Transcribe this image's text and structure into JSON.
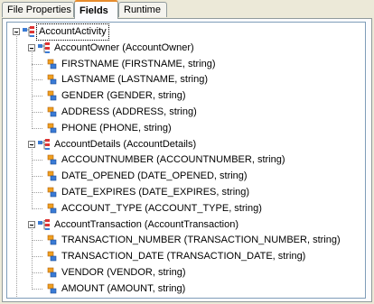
{
  "tabs": [
    {
      "label": "File Properties"
    },
    {
      "label": "Fields"
    },
    {
      "label": "Runtime"
    }
  ],
  "tree": {
    "root": "AccountActivity",
    "groups": [
      {
        "label": "AccountOwner (AccountOwner)",
        "fields": [
          "FIRSTNAME (FIRSTNAME, string)",
          "LASTNAME (LASTNAME, string)",
          "GENDER (GENDER, string)",
          "ADDRESS (ADDRESS, string)",
          "PHONE (PHONE, string)"
        ]
      },
      {
        "label": "AccountDetails (AccountDetails)",
        "fields": [
          "ACCOUNTNUMBER  (ACCOUNTNUMBER,  string)",
          "DATE_OPENED (DATE_OPENED, string)",
          "DATE_EXPIRES (DATE_EXPIRES, string)",
          "ACCOUNT_TYPE (ACCOUNT_TYPE, string)"
        ]
      },
      {
        "label": "AccountTransaction (AccountTransaction)",
        "fields": [
          "TRANSACTION_NUMBER  (TRANSACTION_NUMBER,  string)",
          "TRANSACTION_DATE  (TRANSACTION_DATE, string)",
          "VENDOR (VENDOR, string)",
          "AMOUNT (AMOUNT, string)"
        ]
      }
    ],
    "root_fields": [
      "ACCOUNTNUMBER  (ACCOUNTNUMBER,  string)"
    ]
  }
}
